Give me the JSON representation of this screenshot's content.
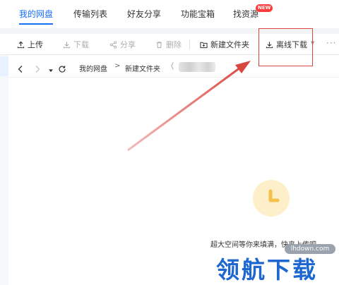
{
  "nav": {
    "tabs": [
      {
        "label": "我的网盘",
        "active": true
      },
      {
        "label": "传输列表",
        "active": false
      },
      {
        "label": "好友分享",
        "active": false
      },
      {
        "label": "功能宝箱",
        "active": false
      },
      {
        "label": "找资源",
        "active": false
      }
    ],
    "new_badge": "NEW"
  },
  "toolbar": {
    "upload": "上传",
    "download": "下载",
    "share": "分享",
    "delete": "删除",
    "new_folder": "新建文件夹",
    "offline_download": "离线下载",
    "more": "···"
  },
  "address": {
    "crumbs": [
      "我的网盘",
      "新建文件夹"
    ],
    "separator": ">"
  },
  "empty_state": {
    "text": "超大空间等你来填满，快来上传吧~"
  },
  "watermark": {
    "url": "lhdown.com",
    "text": "领航下载"
  },
  "colors": {
    "accent": "#1a6dff",
    "highlight": "#d9453f",
    "clock": "#f5c04b"
  }
}
